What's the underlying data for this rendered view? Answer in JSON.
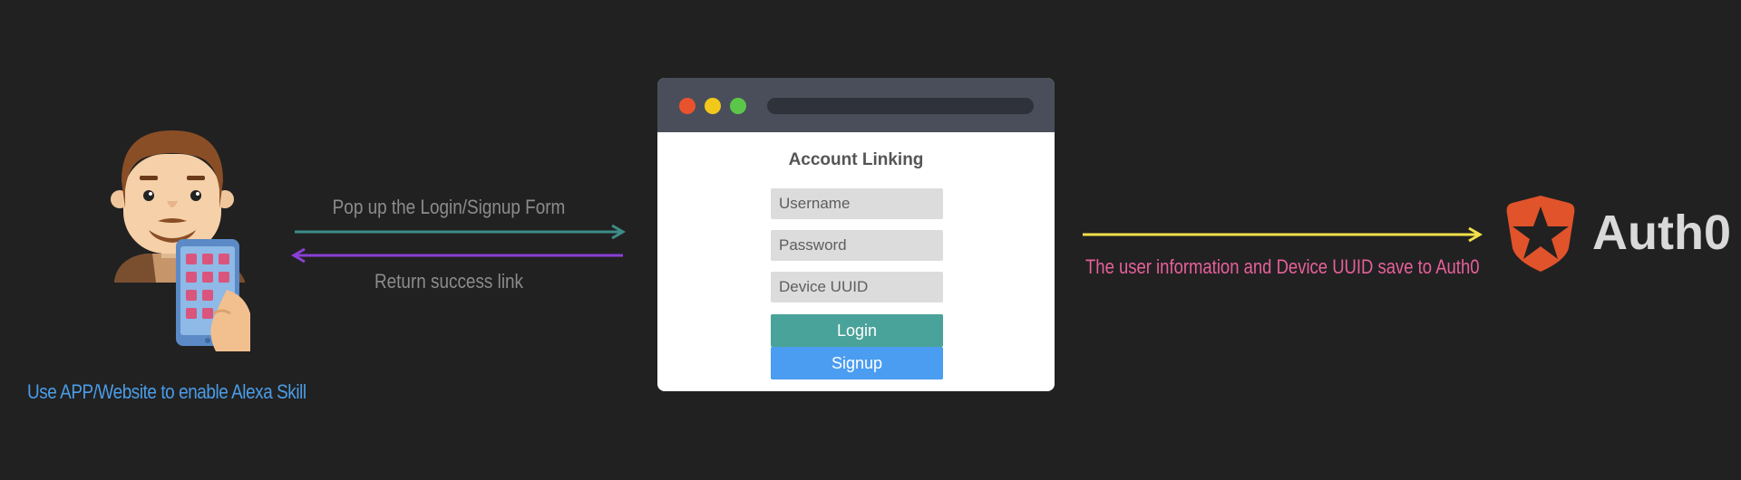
{
  "user": {
    "caption": "Use APP/Website to enable Alexa Skill",
    "caption_color": "#4a9de8",
    "icon": "user-with-phone-icon"
  },
  "flow": {
    "request_label": "Pop up the Login/Signup Form",
    "request_arrow_color": "#3d8c88",
    "response_label": "Return success link",
    "response_arrow_color": "#8a3fd6",
    "save_label": "The user information and Device UUID save to Auth0",
    "save_label_color": "#e8609a",
    "save_arrow_color": "#f2e04a"
  },
  "browser": {
    "title": "Account Linking",
    "window_buttons": [
      "close-dot",
      "minimize-dot",
      "maximize-dot"
    ],
    "window_button_colors": [
      "#e8532e",
      "#f2c81a",
      "#5cc64a"
    ],
    "fields": [
      {
        "placeholder": "Username"
      },
      {
        "placeholder": "Password"
      },
      {
        "placeholder": "Device UUID"
      }
    ],
    "login_label": "Login",
    "login_color": "#4aa39a",
    "signup_label": "Signup",
    "signup_color": "#4a9df0"
  },
  "auth0": {
    "name": "Auth0",
    "brand_color": "#e0532b",
    "icon": "auth0-shield-star-icon"
  }
}
